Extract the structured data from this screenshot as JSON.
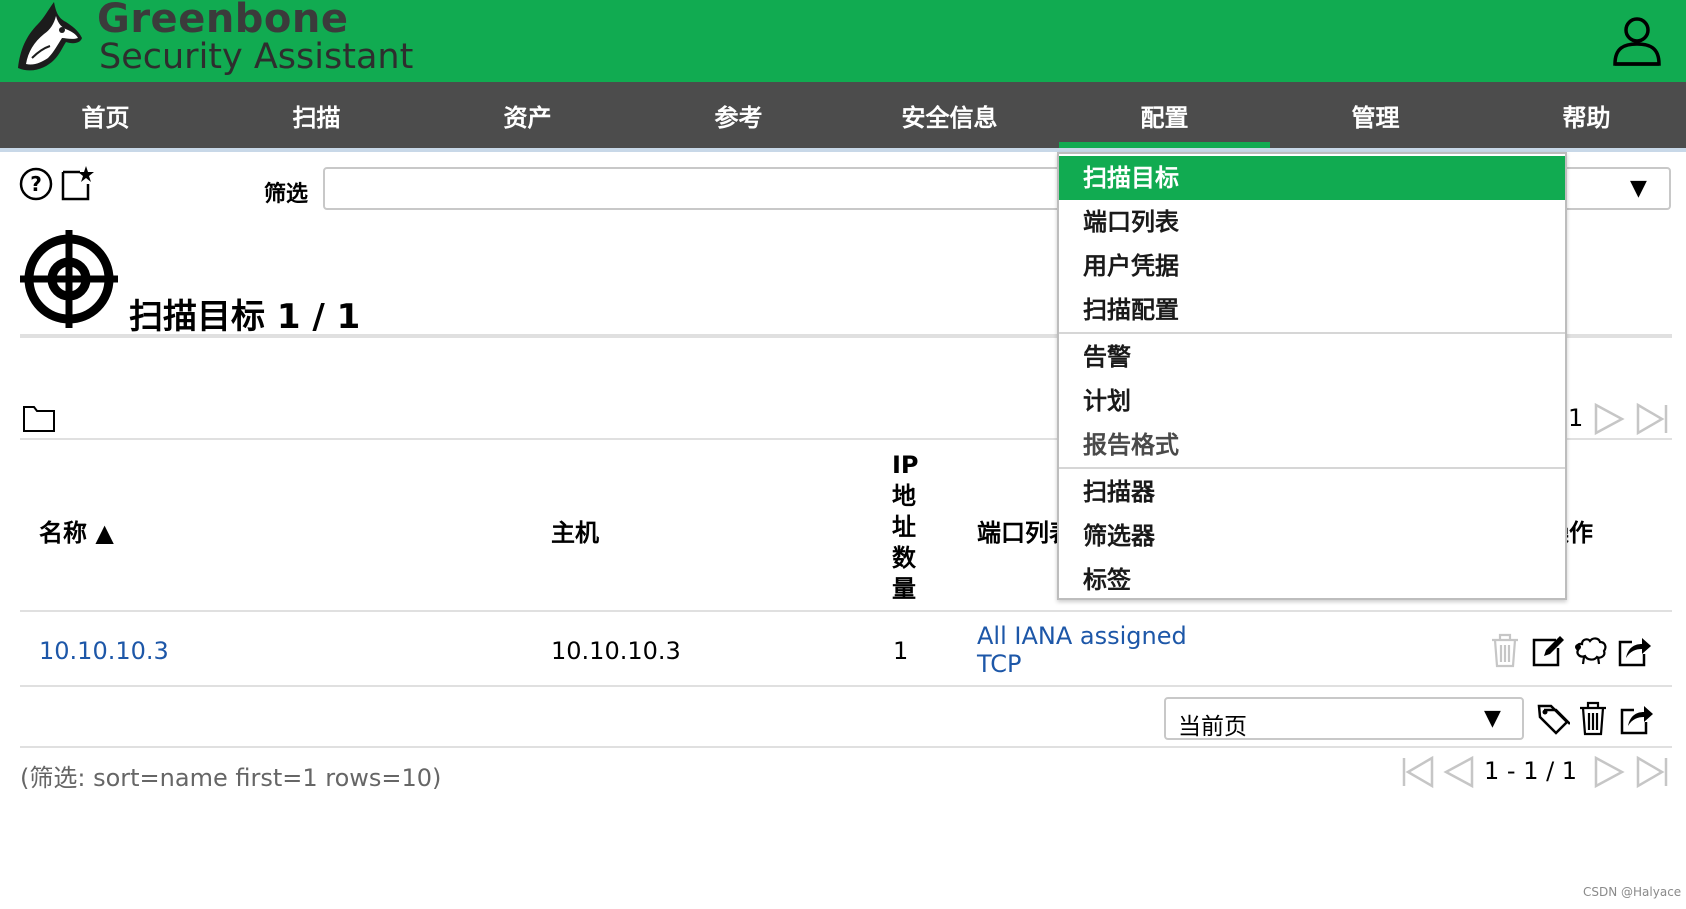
{
  "brand": {
    "name": "Greenbone",
    "product": "Security Assistant",
    "color": "#11ab51"
  },
  "menu": [
    {
      "label": "首页"
    },
    {
      "label": "扫描"
    },
    {
      "label": "资产"
    },
    {
      "label": "参考"
    },
    {
      "label": "安全信息"
    },
    {
      "label": "配置",
      "active": true
    },
    {
      "label": "管理"
    },
    {
      "label": "帮助"
    }
  ],
  "toolbar": {
    "help_icon": "help-circle-icon",
    "new_icon": "new-star-icon",
    "filter_label": "筛选",
    "filter_value": ""
  },
  "page": {
    "title": "扫描目标 1 / 1",
    "title_icon": "crosshair-target-icon",
    "folder_icon": "folder-icon"
  },
  "pagination_top": {
    "text": "1"
  },
  "table": {
    "headers": {
      "name": "名称 ▲",
      "hosts": "主机",
      "ip_count": [
        "IP",
        "地",
        "址",
        "数",
        "量"
      ],
      "port_list": "端口列表",
      "actions": "操作"
    },
    "rows": [
      {
        "name": "10.10.10.3",
        "hosts": "10.10.10.3",
        "ip_count": "1",
        "port_list_line1": "All IANA assigned",
        "port_list_line2": "TCP"
      }
    ]
  },
  "bulk": {
    "selected": "当前页",
    "caret": "▼"
  },
  "footer": {
    "filter_note": "(筛选: sort=name first=1 rows=10)",
    "pagination": "1 - 1 / 1"
  },
  "dropdown": {
    "items": [
      {
        "label": "扫描目标",
        "selected": true
      },
      {
        "label": "端口列表"
      },
      {
        "label": "用户凭据"
      },
      {
        "label": "扫描配置"
      },
      {
        "label": "告警"
      },
      {
        "label": "计划"
      },
      {
        "label": "报告格式",
        "muted": true
      },
      {
        "label": "扫描器"
      },
      {
        "label": "筛选器"
      },
      {
        "label": "标签"
      }
    ]
  },
  "watermark": "CSDN @Halyace"
}
